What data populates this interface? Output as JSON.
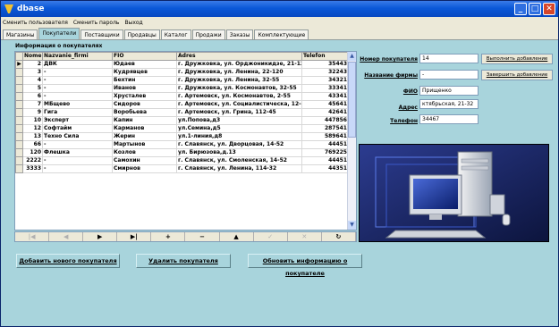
{
  "window": {
    "title": "dbase"
  },
  "menu": [
    "Сменить пользователя",
    "Сменить пароль",
    "Выход"
  ],
  "tabs": [
    "Магазины",
    "Покупатели",
    "Поставщики",
    "Продавцы",
    "Каталог",
    "Продажи",
    "Заказы",
    "Комплектующие"
  ],
  "active_tab": 1,
  "section_title": "Информация о покупателях",
  "grid": {
    "columns": [
      "Nomer",
      "Nazvanie_firmi",
      "FIO",
      "Adres",
      "Telefon"
    ],
    "rows": [
      {
        "indicator": "▶",
        "nomer": "2",
        "firm": "ДВК",
        "fio": "Юдаев",
        "adres": "г. Дружковка, ул. Орджоникидзе, 21-120",
        "tel": "35443"
      },
      {
        "indicator": "",
        "nomer": "3",
        "firm": "-",
        "fio": "Кудрявцев",
        "adres": "г. Дружковка, ул. Ленина, 22-120",
        "tel": "32243"
      },
      {
        "indicator": "",
        "nomer": "4",
        "firm": "-",
        "fio": "Бехтин",
        "adres": "г. Дружковка, ул. Ленина, 32-55",
        "tel": "34321"
      },
      {
        "indicator": "",
        "nomer": "5",
        "firm": "-",
        "fio": "Иванов",
        "adres": "г. Дружковка, ул. Космонавтов, 32-55",
        "tel": "33341"
      },
      {
        "indicator": "",
        "nomer": "6",
        "firm": "-",
        "fio": "Хрусталев",
        "adres": "г. Артемовск, ул. Космонавтов, 2-55",
        "tel": "43341"
      },
      {
        "indicator": "",
        "nomer": "7",
        "firm": "МБщево",
        "fio": "Сидоров",
        "adres": "г. Артемовск, ул. Социалистическа, 12-4",
        "tel": "45641"
      },
      {
        "indicator": "",
        "nomer": "9",
        "firm": "Гига",
        "fio": "Воробьева",
        "adres": "г. Артемовск, ул. Грина, 112-45",
        "tel": "42641"
      },
      {
        "indicator": "",
        "nomer": "10",
        "firm": "Эксперт",
        "fio": "Капин",
        "adres": "ул.Попова,д3",
        "tel": "447856"
      },
      {
        "indicator": "",
        "nomer": "12",
        "firm": "Софтайм",
        "fio": "Карманов",
        "adres": "ул.Семина,д5",
        "tel": "287541"
      },
      {
        "indicator": "",
        "nomer": "13",
        "firm": "Техно Сила",
        "fio": "Жерин",
        "adres": "ул.1-линия,д8",
        "tel": "589641"
      },
      {
        "indicator": "",
        "nomer": "66",
        "firm": "-",
        "fio": "Мартынов",
        "adres": "г. Славянск, ул. Дворцовая, 14-52",
        "tel": "44451"
      },
      {
        "indicator": "",
        "nomer": "120",
        "firm": "Флешка",
        "fio": "Козлов",
        "adres": "ул. Бирюзова,д.13",
        "tel": "769225"
      },
      {
        "indicator": "",
        "nomer": "2222",
        "firm": "-",
        "fio": "Самохин",
        "adres": "г. Славянск, ул. Смоленская, 14-52",
        "tel": "44451"
      },
      {
        "indicator": "",
        "nomer": "3333",
        "firm": "-",
        "fio": "Смирнов",
        "adres": "г. Славянск, ул. Ленина, 114-32",
        "tel": "44351"
      }
    ]
  },
  "navigator": [
    {
      "glyph": "|◀",
      "enabled": false
    },
    {
      "glyph": "◀",
      "enabled": false
    },
    {
      "glyph": "▶",
      "enabled": true
    },
    {
      "glyph": "▶|",
      "enabled": true
    },
    {
      "glyph": "+",
      "enabled": true
    },
    {
      "glyph": "−",
      "enabled": true
    },
    {
      "glyph": "▲",
      "enabled": true
    },
    {
      "glyph": "✓",
      "enabled": false
    },
    {
      "glyph": "✕",
      "enabled": false
    },
    {
      "glyph": "↻",
      "enabled": true
    }
  ],
  "form": {
    "nomer_label": "Номер покупателя",
    "nomer_value": "14",
    "firm_label": "Название фирмы",
    "firm_value": "-",
    "fio_label": "ФИО",
    "fio_value": "Прищенко",
    "adres_label": "Адрес",
    "adres_value": "ктябрьская, 21-32",
    "tel_label": "Телефон",
    "tel_value": "34467"
  },
  "right_buttons": {
    "run_add": "Выполнить добавление",
    "finish_add": "Завершить добавление"
  },
  "bottom_buttons": {
    "add": "Добавить нового покупателя",
    "delete": "Удалить покупателя",
    "update": "Обновить информацию о покупателе"
  },
  "colors": {
    "titlebar": "#0a58d8",
    "background": "#a8d4dc",
    "picture_bg": "#1e2a6a"
  }
}
